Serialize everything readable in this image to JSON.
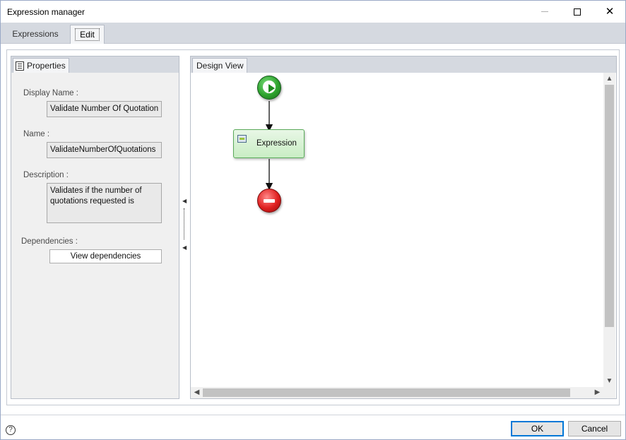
{
  "window": {
    "title": "Expression manager",
    "minimize_icon": "minimize-icon",
    "maximize_icon": "maximize-icon",
    "close_icon": "close-icon",
    "close_glyph": "✕"
  },
  "tabs": [
    {
      "label": "Expressions",
      "active": false
    },
    {
      "label": "Edit",
      "active": true
    }
  ],
  "properties": {
    "tab_label": "Properties",
    "tab_icon": "properties-icon",
    "display_name_label": "Display Name :",
    "display_name_value": "Validate Number Of Quotation",
    "name_label": "Name :",
    "name_value": "ValidateNumberOfQuotations",
    "description_label": "Description :",
    "description_value": "Validates if the number of quotations requested is",
    "dependencies_label": "Dependencies :",
    "view_dependencies_button": "View dependencies"
  },
  "design_view": {
    "tab_label": "Design View",
    "nodes": {
      "start_icon": "start-play-icon",
      "expression_label": "Expression",
      "expression_icon": "expression-icon",
      "stop_icon": "stop-icon"
    },
    "scroll_up": "▲",
    "scroll_down": "▼",
    "scroll_left": "◀",
    "scroll_right": "▶"
  },
  "splitter": {
    "arrow_left": "◀"
  },
  "footer": {
    "help_glyph": "?",
    "ok_button": "OK",
    "cancel_button": "Cancel"
  },
  "colors": {
    "accent": "#0078d7",
    "tab_strip": "#d5d9e0",
    "start_green": "#2ea32e",
    "stop_red": "#e02020",
    "expression_fill": "#c9edc4"
  }
}
